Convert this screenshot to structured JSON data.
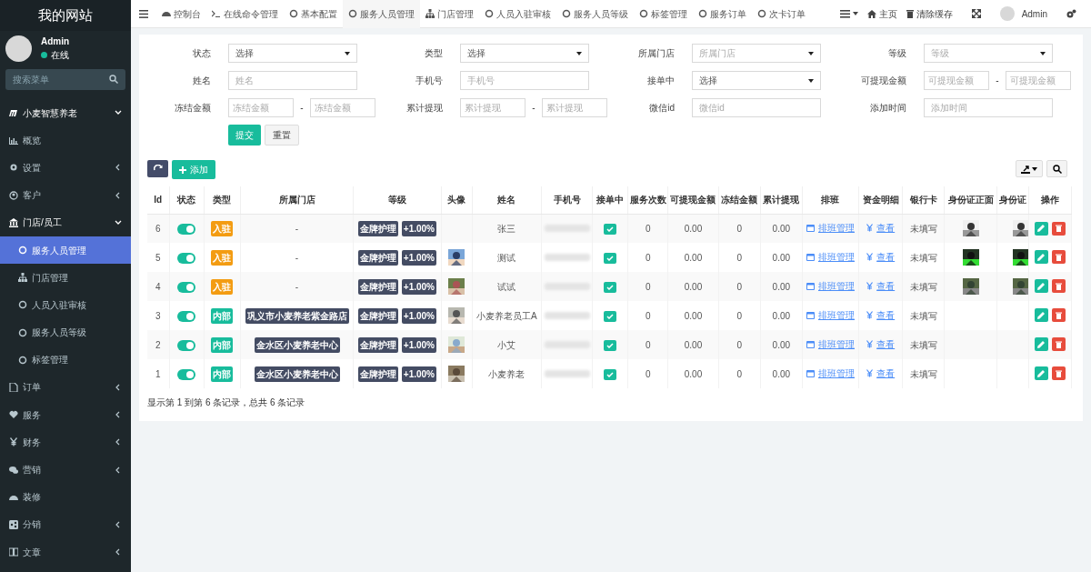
{
  "sidebar": {
    "site_title": "我的网站",
    "user": {
      "name": "Admin",
      "status": "在线"
    },
    "search": {
      "placeholder": "搜索菜单"
    },
    "items": [
      {
        "kind": "group",
        "label": "小麦智慧养老",
        "expanded": true
      },
      {
        "kind": "link",
        "label": "概览"
      },
      {
        "kind": "group",
        "label": "设置",
        "expanded": false
      },
      {
        "kind": "group",
        "label": "客户",
        "expanded": false
      },
      {
        "kind": "group",
        "label": "门店/员工",
        "expanded": true,
        "children": [
          {
            "label": "服务人员管理",
            "selected": true
          },
          {
            "label": "门店管理",
            "selected": false
          },
          {
            "label": "人员入驻审核",
            "selected": false
          },
          {
            "label": "服务人员等级",
            "selected": false
          },
          {
            "label": "标签管理",
            "selected": false
          }
        ]
      },
      {
        "kind": "group",
        "label": "订单",
        "expanded": false
      },
      {
        "kind": "group",
        "label": "服务",
        "expanded": false
      },
      {
        "kind": "group",
        "label": "财务",
        "expanded": false
      },
      {
        "kind": "group",
        "label": "营销",
        "expanded": false
      },
      {
        "kind": "link",
        "label": "装修"
      },
      {
        "kind": "group",
        "label": "分销",
        "expanded": false
      },
      {
        "kind": "group",
        "label": "文章",
        "expanded": false
      }
    ]
  },
  "tabs": [
    {
      "label": "控制台",
      "selected": false
    },
    {
      "label": "在线命令管理",
      "selected": false
    },
    {
      "label": "基本配置",
      "selected": false
    },
    {
      "label": "服务人员管理",
      "selected": true
    },
    {
      "label": "门店管理",
      "selected": false
    },
    {
      "label": "人员入驻审核",
      "selected": false
    },
    {
      "label": "服务人员等级",
      "selected": false
    },
    {
      "label": "标签管理",
      "selected": false
    },
    {
      "label": "服务订单",
      "selected": false
    },
    {
      "label": "次卡订单",
      "selected": false
    }
  ],
  "toolbar": {
    "home": "主页",
    "clear_cache": "清除缓存",
    "user": "Admin"
  },
  "filters": [
    {
      "label": "状态",
      "kind": "select",
      "value": "选择"
    },
    {
      "label": "类型",
      "kind": "select",
      "value": "选择"
    },
    {
      "label": "所属门店",
      "kind": "select",
      "placeholder": "所属门店"
    },
    {
      "label": "等级",
      "kind": "select",
      "placeholder": "等级"
    },
    {
      "label": "姓名",
      "kind": "text",
      "placeholder": "姓名"
    },
    {
      "label": "手机号",
      "kind": "text",
      "placeholder": "手机号"
    },
    {
      "label": "接单中",
      "kind": "select",
      "value": "选择"
    },
    {
      "label": "可提现金额",
      "kind": "range",
      "placeholder": "可提现金额",
      "placeholder_to": "可提现金额",
      "separator": "-"
    },
    {
      "label": "冻结金额",
      "kind": "range",
      "placeholder": "冻结金额",
      "placeholder_to": "冻结金额",
      "separator": "-"
    },
    {
      "label": "累计提现",
      "kind": "range",
      "placeholder": "累计提现",
      "placeholder_to": "累计提现",
      "separator": "-"
    },
    {
      "label": "微信id",
      "kind": "text",
      "placeholder": "微信id"
    },
    {
      "label": "添加时间",
      "kind": "text",
      "placeholder": "添加时间"
    }
  ],
  "form_buttons": [
    "提交",
    "重置"
  ],
  "add_button": "添加",
  "table": {
    "columns": [
      "Id",
      "状态",
      "类型",
      "所属门店",
      "等级",
      "头像",
      "姓名",
      "手机号",
      "接单中",
      "服务次数",
      "可提现金额",
      "冻结金额",
      "累计提现",
      "排班",
      "资金明细",
      "银行卡",
      "身份证正面",
      "身份证",
      "操作"
    ],
    "rows": [
      {
        "id": "6",
        "on": true,
        "type": "入驻",
        "color": "#f39c12",
        "store": "-",
        "level": "金牌护理",
        "rate": "+1.00%",
        "avatar": false,
        "name": "张三",
        "accepting": true,
        "count": "0",
        "withdrawable": "0.00",
        "frozen": "0",
        "withdrawn": "0.00",
        "schedule": "排班管理",
        "funds": "查看",
        "bank": "未填写",
        "id_front": true,
        "id_back": true
      },
      {
        "id": "5",
        "on": true,
        "type": "入驻",
        "color": "#f39c12",
        "store": "-",
        "level": "金牌护理",
        "rate": "+1.00%",
        "avatar": true,
        "name": "测试",
        "accepting": true,
        "count": "0",
        "withdrawable": "0.00",
        "frozen": "0",
        "withdrawn": "0.00",
        "schedule": "排班管理",
        "funds": "查看",
        "bank": "未填写",
        "id_front": true,
        "id_back": true
      },
      {
        "id": "4",
        "on": true,
        "type": "入驻",
        "color": "#f39c12",
        "store": "-",
        "level": "金牌护理",
        "rate": "+1.00%",
        "avatar": true,
        "name": "试试",
        "accepting": true,
        "count": "0",
        "withdrawable": "0.00",
        "frozen": "0",
        "withdrawn": "0.00",
        "schedule": "排班管理",
        "funds": "查看",
        "bank": "未填写",
        "id_front": true,
        "id_back": true
      },
      {
        "id": "3",
        "on": true,
        "type": "内部",
        "color": "#18bc9c",
        "store_tag": "巩义市小麦养老紫金路店",
        "level": "金牌护理",
        "rate": "+1.00%",
        "avatar": true,
        "name": "小麦养老员工A",
        "accepting": true,
        "count": "0",
        "withdrawable": "0.00",
        "frozen": "0",
        "withdrawn": "0.00",
        "schedule": "排班管理",
        "funds": "查看",
        "bank": "未填写",
        "id_front": false,
        "id_back": false
      },
      {
        "id": "2",
        "on": true,
        "type": "内部",
        "color": "#18bc9c",
        "store_tag": "金水区小麦养老中心",
        "level": "金牌护理",
        "rate": "+1.00%",
        "avatar": true,
        "name": "小艾",
        "accepting": true,
        "count": "0",
        "withdrawable": "0.00",
        "frozen": "0",
        "withdrawn": "0.00",
        "schedule": "排班管理",
        "funds": "查看",
        "bank": "未填写",
        "id_front": false,
        "id_back": false
      },
      {
        "id": "1",
        "on": true,
        "type": "内部",
        "color": "#18bc9c",
        "store_tag": "金水区小麦养老中心",
        "level": "金牌护理",
        "rate": "+1.00%",
        "avatar": true,
        "name": "小麦养老",
        "accepting": true,
        "count": "0",
        "withdrawable": "0.00",
        "frozen": "0",
        "withdrawn": "0.00",
        "schedule": "排班管理",
        "funds": "查看",
        "bank": "未填写",
        "id_front": false,
        "id_back": false
      }
    ]
  },
  "pagination_info": "显示第 1 到第 6 条记录，总共 6 条记录"
}
